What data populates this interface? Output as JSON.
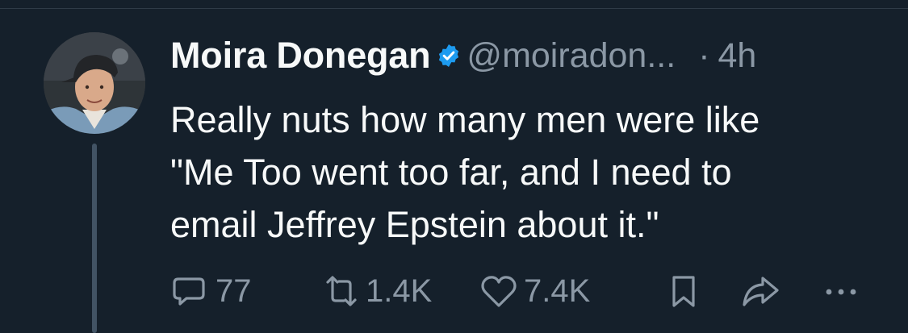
{
  "tweet": {
    "author_name": "Moira Donegan",
    "handle": "@moiradon...",
    "separator": "·",
    "time": "4h",
    "text": "Really nuts how many men were like\n\"Me Too went too far, and I need to\nemail Jeffrey Epstein about it.\"",
    "verified": true,
    "verified_color": "#1d9bf0"
  },
  "actions": {
    "reply_count": "77",
    "retweet_count": "1.4K",
    "like_count": "7.4K"
  },
  "icons": [
    "verified-icon",
    "reply-icon",
    "retweet-icon",
    "like-icon",
    "bookmark-icon",
    "share-icon",
    "more-icon"
  ],
  "colors": {
    "background": "#15202b",
    "text": "#f7f9f9",
    "muted": "#8b98a5",
    "thread_line": "#425364"
  }
}
